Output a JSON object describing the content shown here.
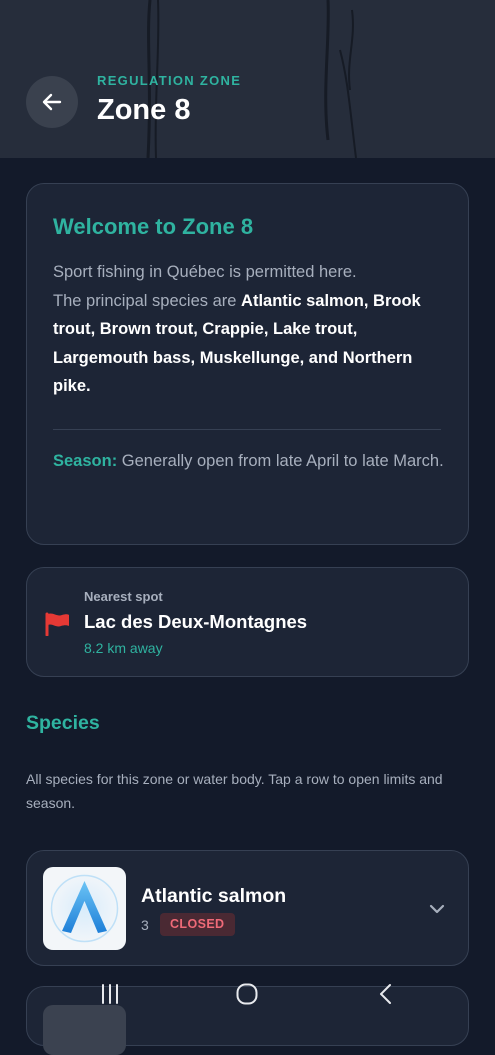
{
  "header": {
    "eyebrow": "REGULATION ZONE",
    "title": "Zone 8",
    "back_icon": "arrow-left-icon"
  },
  "welcome": {
    "title": "Welcome to Zone 8",
    "intro": "Sport fishing in Québec is permitted here.",
    "species_prefix": "The principal species are",
    "species_list": "Atlantic salmon, Brook trout, Brown trout, Crappie, Lake trout, Largemouth bass, Muskellunge, and Northern pike.",
    "season_label": "Season:",
    "season_text": "Generally open from late April to late March."
  },
  "nearest_spot": {
    "label": "Nearest spot",
    "name": "Lac des Deux-Montagnes",
    "distance": "8.2 km away",
    "icon": "flag-icon"
  },
  "species_section": {
    "heading": "Species",
    "description": "All species for this zone or water body. Tap a row to open limits and season.",
    "items": [
      {
        "name": "Atlantic salmon",
        "count": "3",
        "status": "CLOSED"
      }
    ]
  },
  "colors": {
    "accent": "#2fb3a0",
    "background": "#131a2a",
    "card": "#1d2536",
    "closed_badge": "#ef6a78",
    "flag": "#e53935"
  }
}
